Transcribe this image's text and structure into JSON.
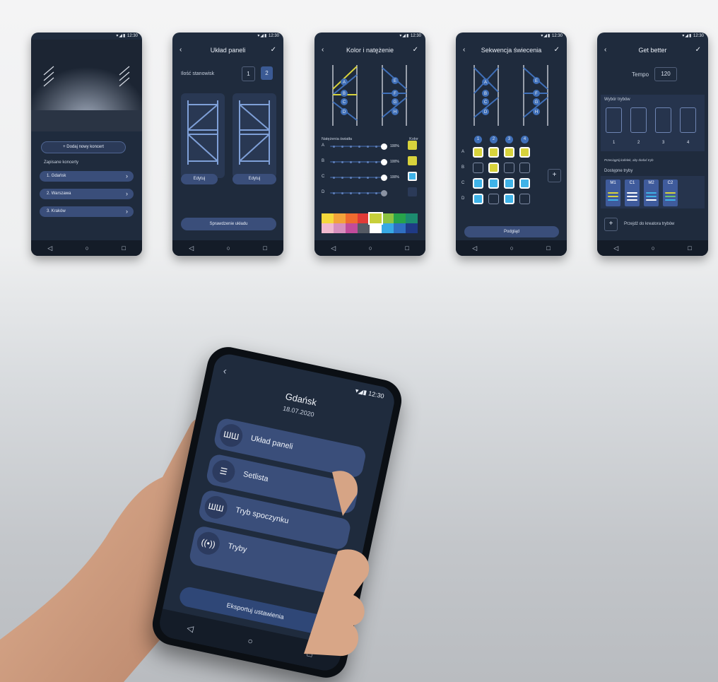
{
  "status": {
    "time": "12:30",
    "icons": "▾◢▮"
  },
  "screen1": {
    "add_button": "+ Dodaj nowy koncert",
    "saved_label": "Zapisane koncerty",
    "concerts": [
      "1. Gdańsk",
      "2. Warszawa",
      "3. Kraków"
    ]
  },
  "screen2": {
    "title": "Układ paneli",
    "count_label": "Ilość stanowisk",
    "options": [
      "1",
      "2"
    ],
    "edit1": "Edytuj",
    "edit2": "Edytuj",
    "check_button": "Sprawdzenie układu"
  },
  "screen3": {
    "title": "Kolor i natężenie",
    "intensity_label": "Natężenia światła",
    "color_label": "Kolor",
    "rows": [
      {
        "letter": "A",
        "pct": "100%",
        "color": "#d8d33c",
        "level": 1.0
      },
      {
        "letter": "B",
        "pct": "100%",
        "color": "#d8d33c",
        "level": 1.0
      },
      {
        "letter": "C",
        "pct": "100%",
        "color": "#3fb3e8",
        "level": 1.0
      },
      {
        "letter": "D",
        "pct": "",
        "color": "",
        "level": 1.0
      }
    ],
    "labels_left": [
      "A",
      "B",
      "C",
      "D"
    ],
    "labels_right": [
      "E",
      "F",
      "G",
      "H"
    ],
    "palette_top": [
      "#f4d83b",
      "#f2a33a",
      "#ee6b2f",
      "#e03a37",
      "#c8cf3a",
      "#8dc341",
      "#27a34a",
      "#1c8b6f"
    ],
    "palette_bottom": [
      "#f0b9cf",
      "#d78fbe",
      "#c24b9b",
      "#555a64",
      "#ffffff",
      "#37a9e4",
      "#2f6fc1",
      "#1f3a86"
    ]
  },
  "screen4": {
    "title": "Sekwencja świecenia",
    "cols": [
      "1",
      "2",
      "3",
      "4"
    ],
    "rows": [
      "A",
      "B",
      "C",
      "D"
    ],
    "grid": [
      [
        "#d8d33c",
        "#d8d33c",
        "#d8d33c",
        "#d8d33c"
      ],
      [
        "",
        "#d8d33c",
        "",
        ""
      ],
      [
        "#3fb3e8",
        "#3fb3e8",
        "#3fb3e8",
        "#3fb3e8"
      ],
      [
        "#3fb3e8",
        "",
        "#3fb3e8",
        ""
      ]
    ],
    "labels_left": [
      "A",
      "B",
      "C",
      "D"
    ],
    "labels_right": [
      "E",
      "F",
      "G",
      "H"
    ],
    "add": "+",
    "preview_button": "Podgląd"
  },
  "screen5": {
    "title": "Get better",
    "tempo_label": "Tempo",
    "tempo_value": "120",
    "modes_label": "Wybór trybów",
    "slots": [
      "1",
      "2",
      "3",
      "4"
    ],
    "hint": "Przeciągnij kafelek, aby dodać tryb",
    "available_label": "Dostępne tryby",
    "available": [
      "M1",
      "C1",
      "M2",
      "C2"
    ],
    "creator_plus": "+",
    "creator_link": "Przejdź do kreatora trybów"
  },
  "main": {
    "back": "‹",
    "title": "Gdańsk",
    "date": "18.07.2020",
    "items": [
      {
        "label": "Układ paneli",
        "icon": "panels-icon"
      },
      {
        "label": "Setlista",
        "icon": "list-icon"
      },
      {
        "label": "Tryb spoczynku",
        "icon": "panels-icon"
      },
      {
        "label": "Tryby",
        "icon": "broadcast-icon"
      }
    ],
    "export": "Eksportuj ustawienia"
  },
  "nav": {
    "back": "◁",
    "home": "○",
    "recent": "□"
  }
}
